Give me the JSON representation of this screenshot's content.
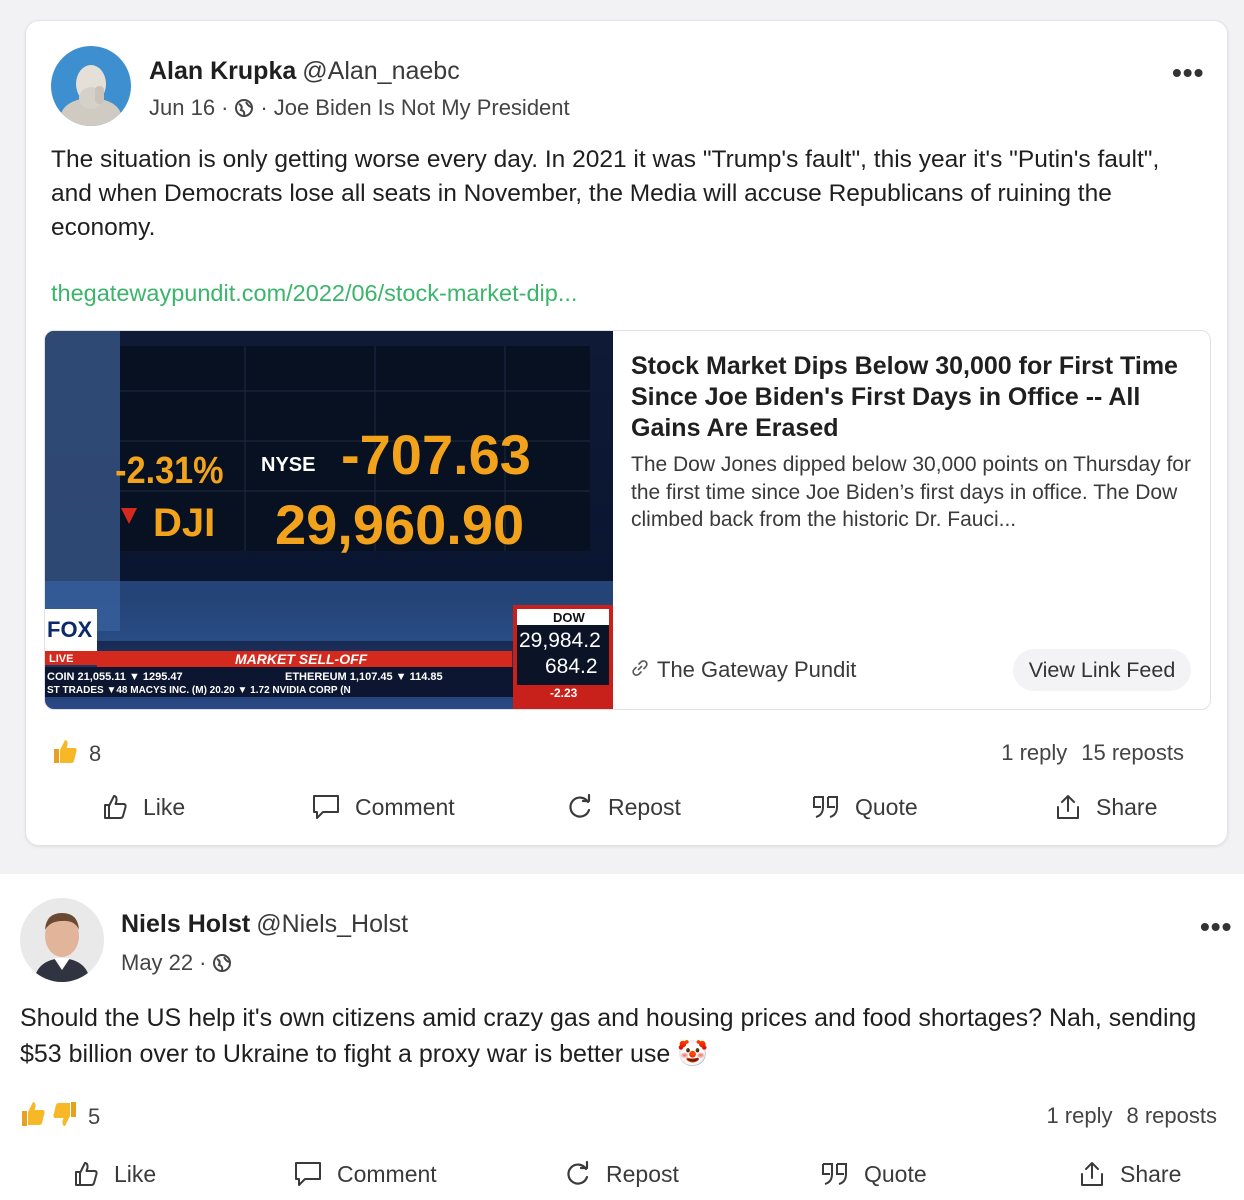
{
  "post1": {
    "author_name": "Alan Krupka",
    "author_handle": "@Alan_naebc",
    "date": "Jun 16",
    "group": "Joe Biden Is Not My President",
    "more_label": "•••",
    "text": "The situation is only getting worse every day. In 2021 it was \"Trump's fault\", this year it's \"Putin's fault\", and when Democrats lose all seats in November, the Media will accuse Republicans of ruining the economy.",
    "link": "thegatewaypundit.com/2022/06/stock-market-dip...",
    "preview": {
      "title": "Stock Market Dips Below 30,000 for First Time Since Joe Biden's First Days in Office -- All Gains Are Erased",
      "description": "The Dow Jones dipped below 30,000 points on Thursday for the first time since Joe Biden’s first days in office. The Dow climbed back from the historic Dr. Fauci...",
      "source": "The Gateway Pundit",
      "view_feed_label": "View Link Feed",
      "image": {
        "pct_change": "-2.31%",
        "index": "DJI",
        "exchange": "NYSE",
        "points_change": "-707.63",
        "index_value": "29,960.90",
        "dow_label": "DOW",
        "dow_value": "29,984.2",
        "dow_change": "684.2",
        "dow_pct": "-2.23",
        "banner": "MARKET SELL-OFF",
        "ticker_1": "COIN 21,055.11 ▼ 1295.47",
        "ticker_2": "ETHEREUM 1,107.45 ▼ 114.85",
        "ticker_3": "ST TRADES ▼48 MACYS INC. (M) 20.20 ▼ 1.72 NVIDIA CORP (N",
        "network": "FOX",
        "live": "LIVE"
      }
    },
    "reaction_count": "8",
    "replies": "1 reply",
    "reposts": "15 reposts"
  },
  "post2": {
    "author_name": "Niels Holst",
    "author_handle": "@Niels_Holst",
    "date": "May 22",
    "more_label": "•••",
    "text": "Should the US help it's own citizens amid crazy gas and housing prices and food shortages? Nah, sending $53 billion over to Ukraine to fight a proxy war is better use",
    "emoji": "🤡",
    "reaction_count": "5",
    "replies": "1 reply",
    "reposts": "8 reposts"
  },
  "actions": {
    "like": "Like",
    "comment": "Comment",
    "repost": "Repost",
    "quote": "Quote",
    "share": "Share"
  },
  "colors": {
    "link": "#3bb56a",
    "band": "#f2f2f4",
    "ticker_orange": "#f2a31b",
    "ticker_red": "#d42a1e"
  }
}
